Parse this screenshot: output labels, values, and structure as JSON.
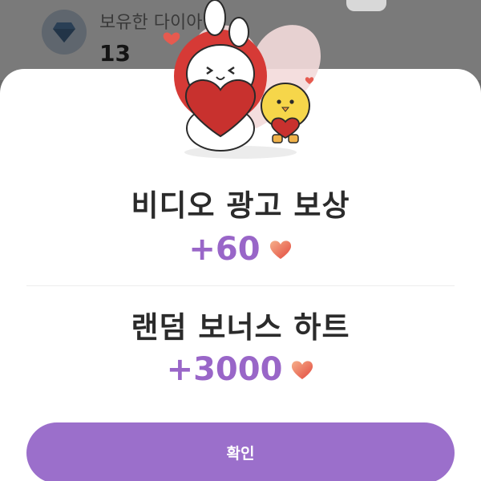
{
  "background": {
    "owned_label": "보유한 다이아",
    "owned_value": "13",
    "diamond_icon": "diamond-icon"
  },
  "dialog": {
    "illustration": "bunny-and-chick-holding-hearts",
    "ad_reward": {
      "title": "비디오 광고 보상",
      "amount": "+60",
      "icon": "heart-icon"
    },
    "random_bonus": {
      "title": "랜덤 보너스 하트",
      "amount": "+3000",
      "icon": "heart-icon"
    },
    "confirm_label": "확인"
  },
  "colors": {
    "accent": "#9b6fcb",
    "amount_text": "#9966c8",
    "heart": "#e8604a",
    "overlay": "#6b6b6b"
  }
}
